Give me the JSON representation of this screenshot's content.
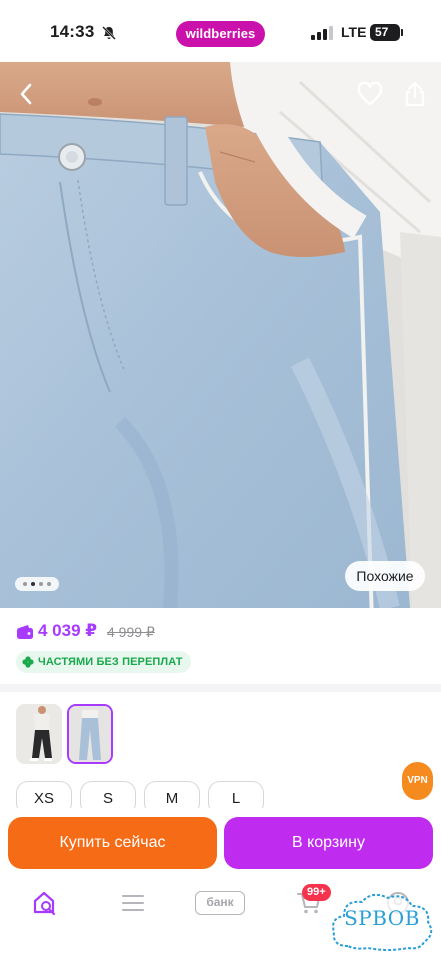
{
  "status_bar": {
    "time": "14:33",
    "brand": "wildberries",
    "network": "LTE",
    "battery": "57"
  },
  "product": {
    "similar_label": "Похожие",
    "gallery_total_dots": 4,
    "gallery_active_dot": 2,
    "price": "4 039 ₽",
    "old_price": "4 999 ₽",
    "installments_label": "ЧАСТЯМИ БЕЗ ПЕРЕПЛАТ"
  },
  "sizes": [
    "XS",
    "S",
    "M",
    "L"
  ],
  "vpn_badge": "VPN",
  "actions": {
    "buy_now": "Купить сейчас",
    "add_to_cart": "В корзину"
  },
  "nav": {
    "bank_label": "банк",
    "cart_badge": "99+"
  },
  "watermark": "SPBOB",
  "colors": {
    "brand": "#cb11ab",
    "price": "#a73afd",
    "buy_now": "#f56b16",
    "cart_button": "#c02bf0",
    "installments": "#1aa84d",
    "badge_red": "#f5334d"
  },
  "icons": [
    "bell-muted-icon",
    "signal-icon",
    "back-icon",
    "heart-icon",
    "share-icon",
    "wallet-icon",
    "clover-icon",
    "home-search-icon",
    "menu-icon",
    "cart-icon",
    "profile-icon"
  ]
}
